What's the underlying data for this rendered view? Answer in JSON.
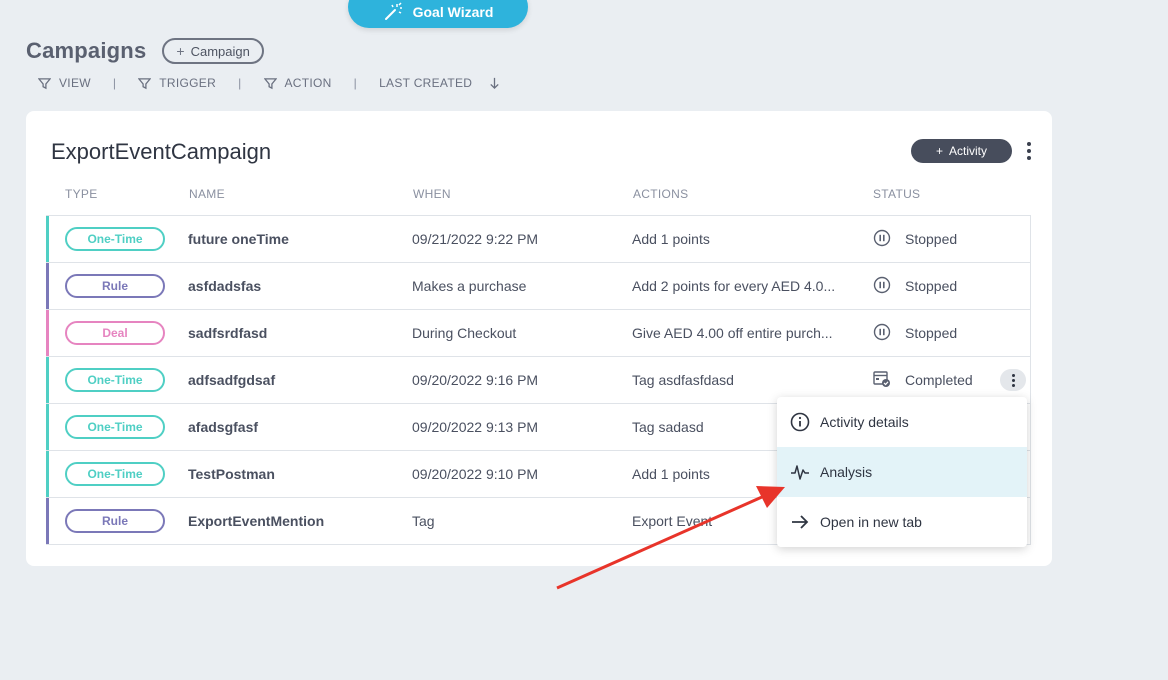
{
  "goal_wizard": {
    "label": "Goal Wizard",
    "icon": "magic-wand-icon"
  },
  "page": {
    "title": "Campaigns",
    "add_campaign_label": "Campaign"
  },
  "filters": {
    "view": "VIEW",
    "trigger": "TRIGGER",
    "action": "ACTION",
    "sort": "LAST CREATED",
    "separator": "|"
  },
  "campaign": {
    "title": "ExportEventCampaign",
    "add_activity_label": "Activity",
    "columns": [
      "TYPE",
      "NAME",
      "WHEN",
      "ACTIONS",
      "STATUS"
    ],
    "rows": [
      {
        "type": "One-Time",
        "name": "future oneTime",
        "when": "09/21/2022 9:22 PM",
        "action": "Add 1 points",
        "status": "Stopped",
        "status_icon": "pause-circle-icon"
      },
      {
        "type": "Rule",
        "name": "asfdadsfas",
        "when": "Makes a purchase",
        "action": "Add 2 points for every AED 4.0...",
        "status": "Stopped",
        "status_icon": "pause-circle-icon"
      },
      {
        "type": "Deal",
        "name": "sadfsrdfasd",
        "when": "During Checkout",
        "action": "Give AED 4.00 off entire purch...",
        "status": "Stopped",
        "status_icon": "pause-circle-icon"
      },
      {
        "type": "One-Time",
        "name": "adfsadfgdsaf",
        "when": "09/20/2022 9:16 PM",
        "action": "Tag asdfasfdasd",
        "status": "Completed",
        "status_icon": "completed-calendar-icon"
      },
      {
        "type": "One-Time",
        "name": "afadsgfasf",
        "when": "09/20/2022 9:13 PM",
        "action": "Tag sadasd",
        "status": "",
        "status_icon": ""
      },
      {
        "type": "One-Time",
        "name": "TestPostman",
        "when": "09/20/2022 9:10 PM",
        "action": "Add 1 points",
        "status": "",
        "status_icon": ""
      },
      {
        "type": "Rule",
        "name": "ExportEventMention",
        "when": "Tag",
        "action": "Export Event",
        "status": "",
        "status_icon": ""
      }
    ]
  },
  "context_menu": {
    "items": [
      {
        "label": "Activity details",
        "icon": "info-icon"
      },
      {
        "label": "Analysis",
        "icon": "pulse-icon"
      },
      {
        "label": "Open in new tab",
        "icon": "arrow-right-icon"
      }
    ]
  },
  "colors": {
    "one_time": "#4fcfc4",
    "rule": "#7b78b8",
    "deal": "#e684c0",
    "accent": "#2eb3dc",
    "annotation_arrow": "#e8342a"
  }
}
